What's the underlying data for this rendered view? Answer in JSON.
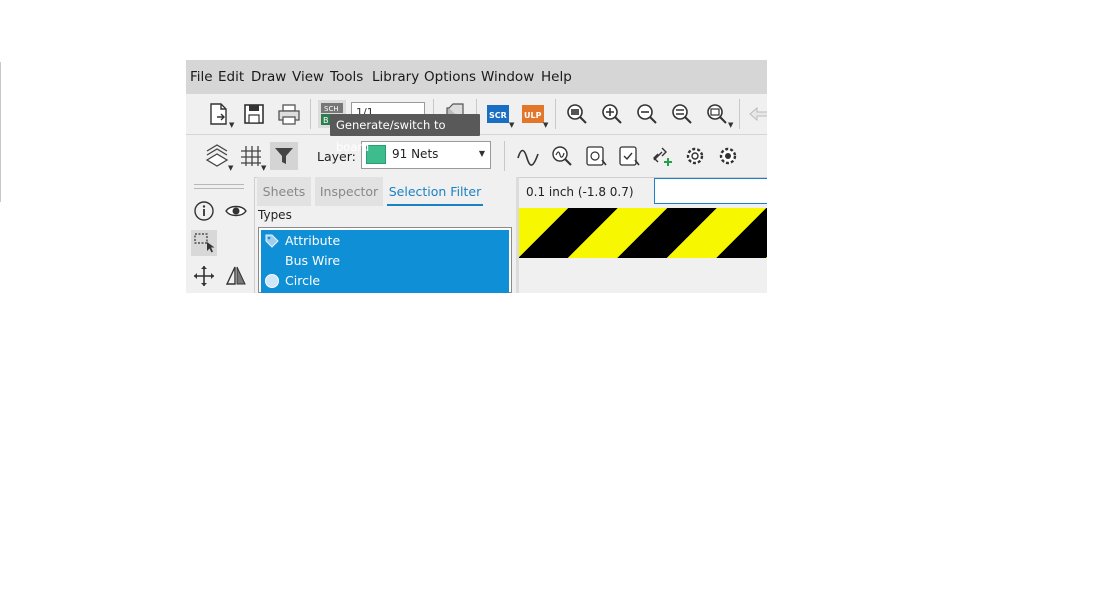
{
  "menu": {
    "items": [
      "File",
      "Edit",
      "Draw",
      "View",
      "Tools",
      "Library",
      "Options",
      "Window",
      "Help"
    ]
  },
  "toolbar_top": {
    "icons": [
      "new-file-icon",
      "save-icon",
      "print-icon",
      "sch-brd-switch-icon",
      "cam-icon",
      "script-icon",
      "ulp-icon",
      "zoom-fit-icon",
      "zoom-in-icon",
      "zoom-out-icon",
      "zoom-redraw-icon",
      "zoom-select-icon",
      "back-arrow-icon"
    ],
    "sheet_value": "1/1",
    "sch_badge": "SCH",
    "brd_badge": "B",
    "scr_badge": "SCR",
    "ulp_badge": "ULP",
    "tooltip": "Generate/switch to board"
  },
  "toolbar_second": {
    "icons": [
      "layer-settings-icon",
      "grid-icon",
      "filter-icon",
      "wire-icon",
      "net-check-icon",
      "erc-icon",
      "erc-pass-icon",
      "add-net-icon",
      "gear-icon",
      "gear-icon"
    ],
    "layer_label": "Layer:",
    "layer_value": "91 Nets",
    "layer_color": "#3dbc8e"
  },
  "left_panel": {
    "icons": [
      "info-icon",
      "eye-icon",
      "select-icon",
      "move-icon",
      "mirror-icon"
    ]
  },
  "tabs": [
    {
      "label": "Sheets",
      "active": false
    },
    {
      "label": "Inspector",
      "active": false
    },
    {
      "label": "Selection Filter",
      "active": true
    }
  ],
  "selection_filter": {
    "types_label": "Types",
    "items": [
      {
        "label": "Attribute",
        "icon": "tag-icon"
      },
      {
        "label": "Bus Wire",
        "icon": ""
      },
      {
        "label": "Circle",
        "icon": "circle-icon"
      }
    ],
    "highlight_color": "#0f8fd6"
  },
  "status": {
    "coordinates": "0.1 inch (-1.8 0.7)",
    "command_input": ""
  },
  "canvas": {
    "stripe_colors": [
      "#f7f700",
      "#000000"
    ]
  }
}
